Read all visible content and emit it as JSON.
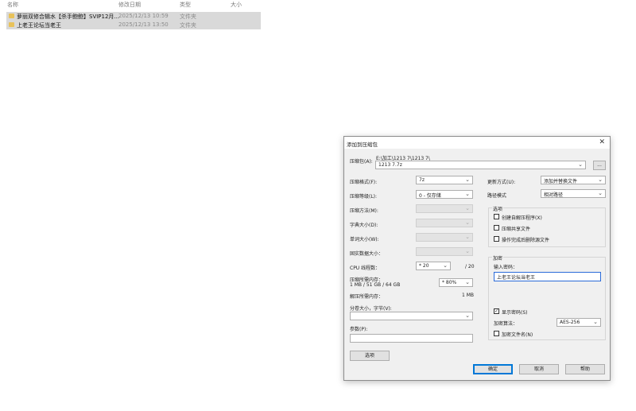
{
  "explorer": {
    "columns": {
      "name": "名称",
      "modified": "修改日期",
      "type": "类型",
      "size": "大小"
    },
    "rows": [
      {
        "name": "萝丽双修合辑水【杀手鲍鲍】SVIP12月...",
        "modified": "2025/12/13 10:59",
        "type": "文件夹"
      },
      {
        "name": "上老王论坛当老王",
        "modified": "2025/12/13 13:50",
        "type": "文件夹"
      }
    ]
  },
  "dialog": {
    "title": "添加到压缩包",
    "close_label": "✕",
    "archive_label": "压缩包(A):",
    "archive_path": "E:\\加工\\1213 7\\1213 7\\",
    "archive_name": "1213 7.7z",
    "browse_label": "...",
    "left": {
      "format_label": "压缩格式(F):",
      "format_value": "7z",
      "level_label": "压缩等级(L):",
      "level_value": "0 - 仅存储",
      "method_label": "压缩方法(M):",
      "dict_label": "字典大小(D):",
      "word_label": "单词大小(W):",
      "solid_label": "固实数据大小：",
      "threads_label": "CPU 线程数：",
      "threads_value": "* 20",
      "threads_total": "/ 20",
      "mem_label": "压缩所需内存：",
      "mem_detail": "1 MB / 51 GB / 64 GB",
      "mem_value": "* 80%",
      "decomp_label": "解压所需内存：",
      "decomp_value": "1 MB",
      "split_label": "分卷大小，字节(V):",
      "params_label": "参数(P):",
      "options_button": "选项"
    },
    "right": {
      "update_label": "更新方式(U):",
      "update_value": "添加并替换文件",
      "path_label": "路径模式",
      "path_value": "相对路径",
      "options_group": "选项",
      "opt_sfx": "创建自解压程序(X)",
      "opt_shared": "压缩共享文件",
      "opt_delete": "操作完成后删除源文件",
      "encrypt_group": "加密",
      "password_label": "输入密码：",
      "password_value": "上老王论坛当老王",
      "show_password": "显示密码(S)",
      "show_password_checked": true,
      "algo_label": "加密算法：",
      "algo_value": "AES-256",
      "encrypt_names": "加密文件名(N)"
    },
    "buttons": {
      "ok": "确定",
      "cancel": "取消",
      "help": "帮助"
    }
  }
}
